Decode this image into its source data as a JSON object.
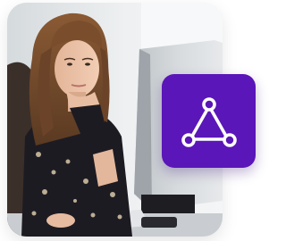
{
  "photo": {
    "subject": "woman-at-computer",
    "alt": ""
  },
  "badge": {
    "icon": "triangle-network-icon",
    "background_color": "#5a16b8",
    "icon_color": "#ffffff"
  }
}
